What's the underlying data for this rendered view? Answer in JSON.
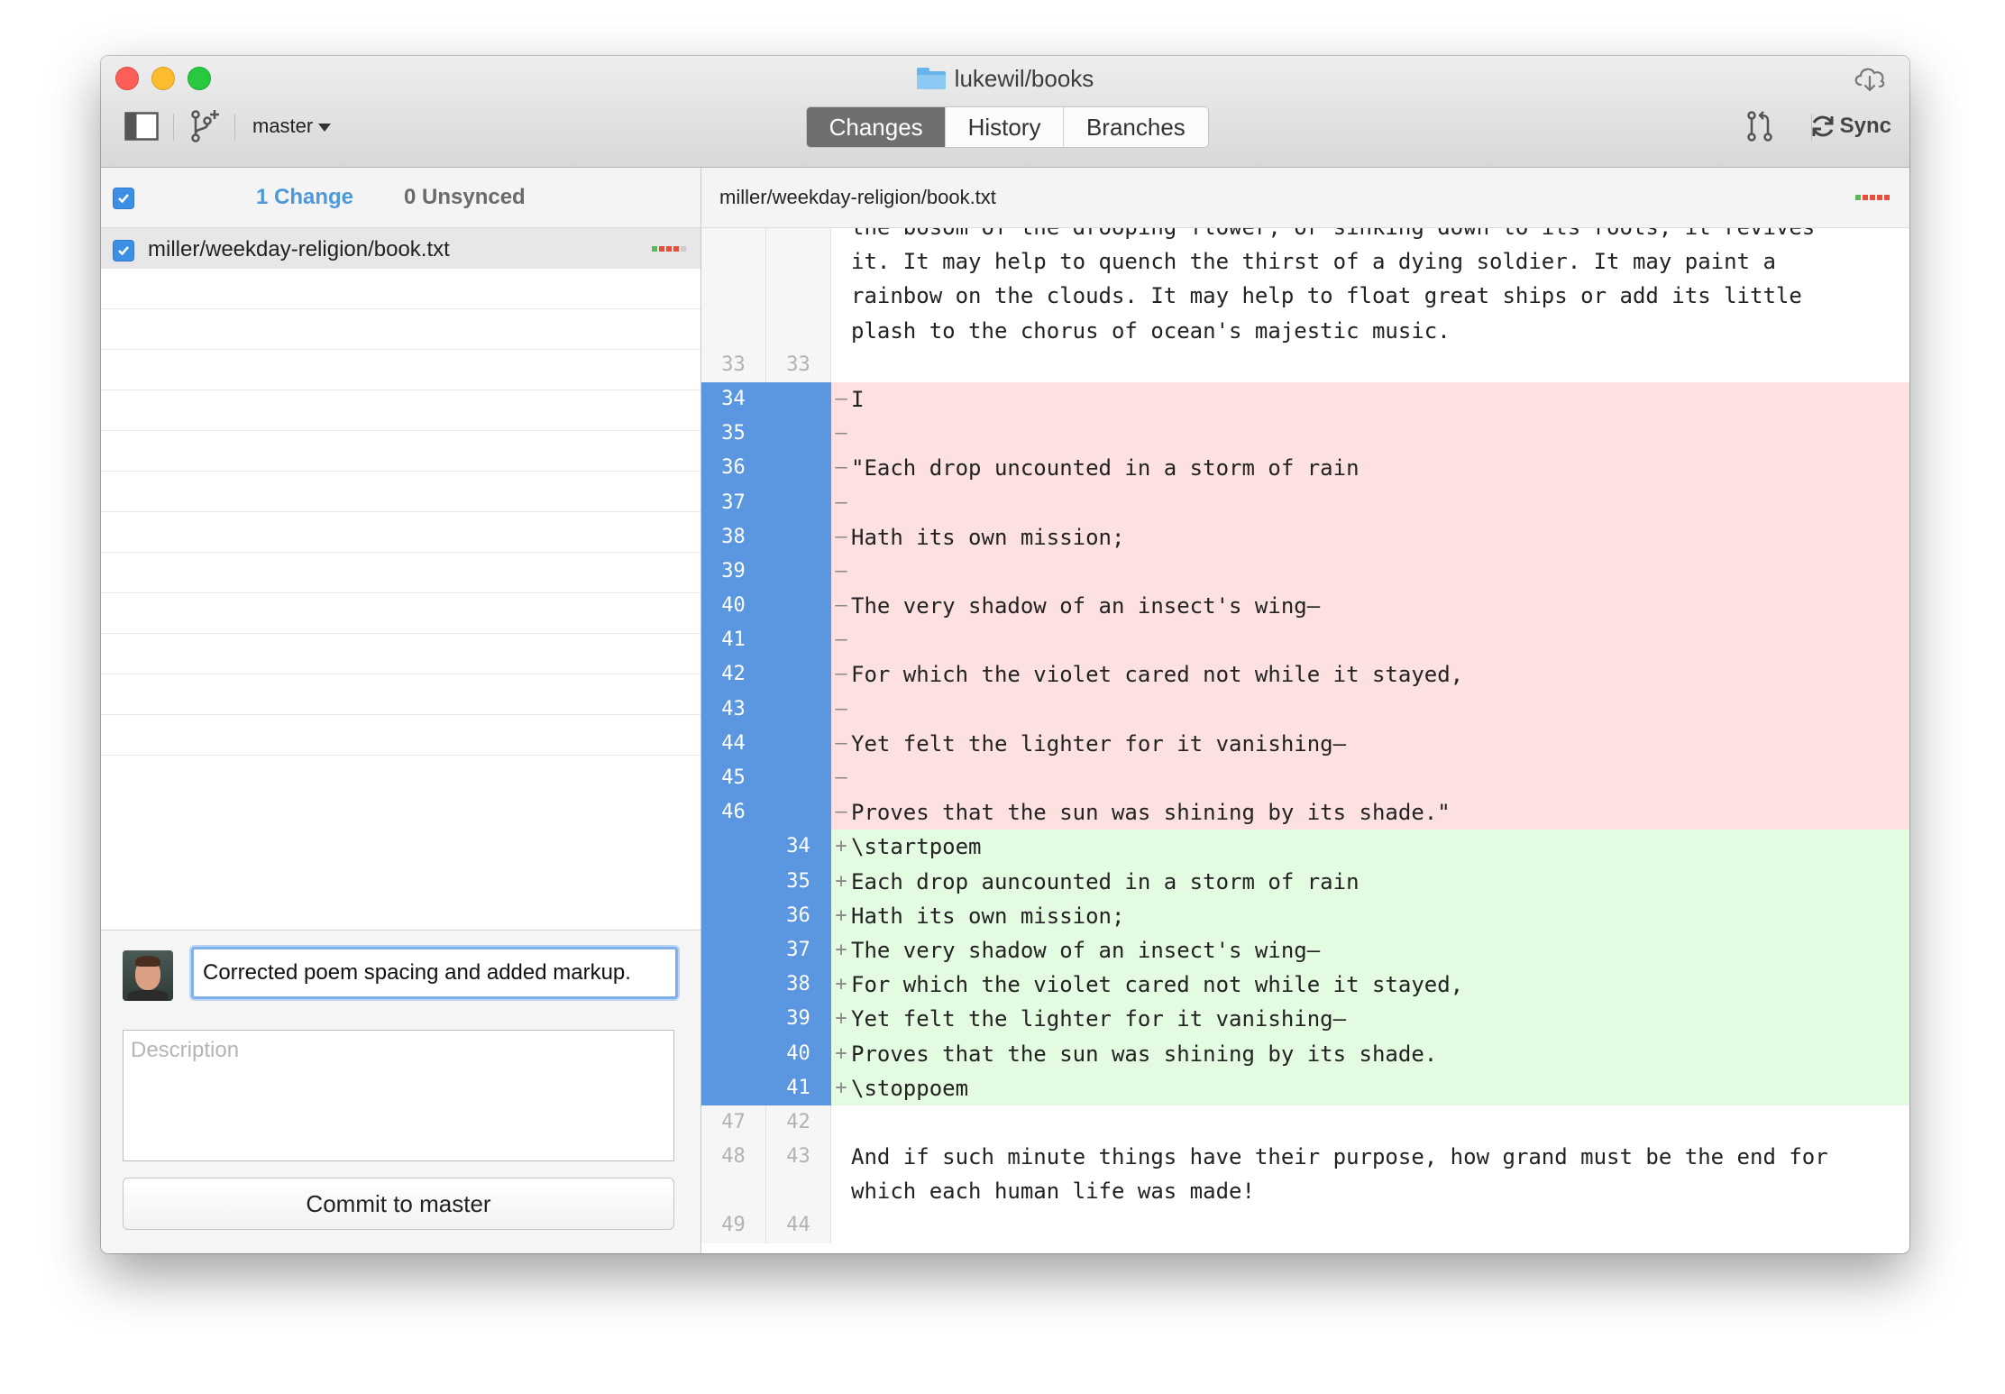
{
  "window": {
    "title": "lukewil/books",
    "branch": "master",
    "tabs": [
      {
        "label": "Changes",
        "active": true
      },
      {
        "label": "History",
        "active": false
      },
      {
        "label": "Branches",
        "active": false
      }
    ],
    "sync_label": "Sync",
    "colors": {
      "accent": "#5b96e0",
      "deleted_bg": "#fde1e1",
      "added_bg": "#e3fbe0",
      "active_tab": "#6f6f6f"
    }
  },
  "changes_panel": {
    "change_count": "1 Change",
    "unsynced_count": "0 Unsynced",
    "files": [
      {
        "path": "miller/weekday-religion/book.txt",
        "checked": true,
        "diffstat": [
          "#5cb85c",
          "#e74c3c",
          "#e74c3c",
          "#e74c3c",
          "#cccccc"
        ]
      }
    ]
  },
  "commit": {
    "summary": "Corrected poem spacing and added markup.",
    "description_placeholder": "Description",
    "button_label": "Commit to master"
  },
  "diff": {
    "file_path": "miller/weekday-religion/book.txt",
    "diffstat": [
      "#5cb85c",
      "#e74c3c",
      "#e74c3c",
      "#e74c3c",
      "#e74c3c"
    ],
    "lines": [
      {
        "type": "ctx",
        "old": "",
        "new": "",
        "marker": "",
        "text": "the bosom of the drooping flower, or sinking down to its roots, it revives"
      },
      {
        "type": "ctx",
        "old": "",
        "new": "",
        "marker": "",
        "text": "it. It may help to quench the thirst of a dying soldier. It may paint a"
      },
      {
        "type": "ctx",
        "old": "",
        "new": "",
        "marker": "",
        "text": "rainbow on the clouds. It may help to float great ships or add its little"
      },
      {
        "type": "ctx",
        "old": "",
        "new": "",
        "marker": "",
        "text": "plash to the chorus of ocean's majestic music."
      },
      {
        "type": "ctx",
        "old": "33",
        "new": "33",
        "marker": "",
        "text": ""
      },
      {
        "type": "del",
        "old": "34",
        "new": "",
        "marker": "–",
        "text": "I"
      },
      {
        "type": "del",
        "old": "35",
        "new": "",
        "marker": "–",
        "text": ""
      },
      {
        "type": "del",
        "old": "36",
        "new": "",
        "marker": "–",
        "text": "\"Each drop uncounted in a storm of rain"
      },
      {
        "type": "del",
        "old": "37",
        "new": "",
        "marker": "–",
        "text": ""
      },
      {
        "type": "del",
        "old": "38",
        "new": "",
        "marker": "–",
        "text": "Hath its own mission;"
      },
      {
        "type": "del",
        "old": "39",
        "new": "",
        "marker": "–",
        "text": ""
      },
      {
        "type": "del",
        "old": "40",
        "new": "",
        "marker": "–",
        "text": "The very shadow of an insect's wing—"
      },
      {
        "type": "del",
        "old": "41",
        "new": "",
        "marker": "–",
        "text": ""
      },
      {
        "type": "del",
        "old": "42",
        "new": "",
        "marker": "–",
        "text": "For which the violet cared not while it stayed,"
      },
      {
        "type": "del",
        "old": "43",
        "new": "",
        "marker": "–",
        "text": ""
      },
      {
        "type": "del",
        "old": "44",
        "new": "",
        "marker": "–",
        "text": "Yet felt the lighter for it vanishing—"
      },
      {
        "type": "del",
        "old": "45",
        "new": "",
        "marker": "–",
        "text": ""
      },
      {
        "type": "del",
        "old": "46",
        "new": "",
        "marker": "–",
        "text": "Proves that the sun was shining by its shade.\""
      },
      {
        "type": "add",
        "old": "",
        "new": "34",
        "marker": "+",
        "text": "\\startpoem"
      },
      {
        "type": "add",
        "old": "",
        "new": "35",
        "marker": "+",
        "text": "Each drop auncounted in a storm of rain"
      },
      {
        "type": "add",
        "old": "",
        "new": "36",
        "marker": "+",
        "text": "Hath its own mission;"
      },
      {
        "type": "add",
        "old": "",
        "new": "37",
        "marker": "+",
        "text": "The very shadow of an insect's wing—"
      },
      {
        "type": "add",
        "old": "",
        "new": "38",
        "marker": "+",
        "text": "For which the violet cared not while it stayed,"
      },
      {
        "type": "add",
        "old": "",
        "new": "39",
        "marker": "+",
        "text": "Yet felt the lighter for it vanishing—"
      },
      {
        "type": "add",
        "old": "",
        "new": "40",
        "marker": "+",
        "text": "Proves that the sun was shining by its shade."
      },
      {
        "type": "add",
        "old": "",
        "new": "41",
        "marker": "+",
        "text": "\\stoppoem"
      },
      {
        "type": "ctx",
        "old": "47",
        "new": "42",
        "marker": "",
        "text": ""
      },
      {
        "type": "ctx",
        "old": "48",
        "new": "43",
        "marker": "",
        "text": "And if such minute things have their purpose, how grand must be the end for which each human life was made!",
        "tall": true
      },
      {
        "type": "ctx",
        "old": "49",
        "new": "44",
        "marker": "",
        "text": ""
      }
    ]
  }
}
